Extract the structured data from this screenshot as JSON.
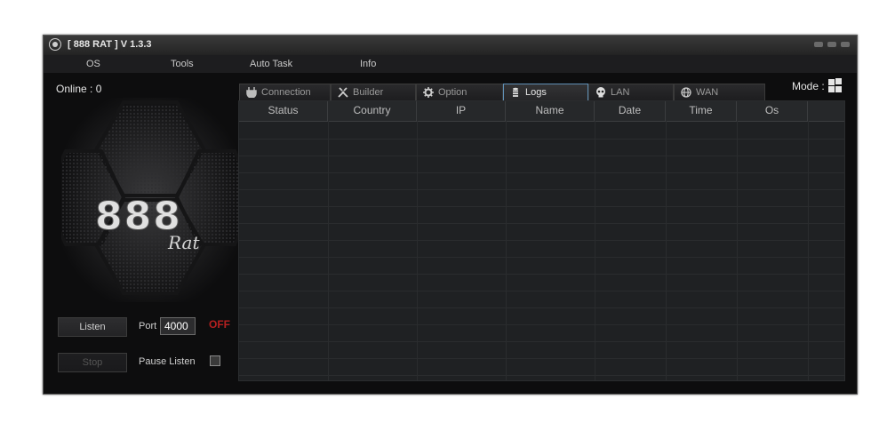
{
  "window": {
    "title": "[ 888 RAT ] V 1.3.3"
  },
  "menu": [
    "OS",
    "Tools",
    "Auto Task",
    "Info"
  ],
  "status": {
    "online_label": "Online : 0",
    "mode_label": "Mode :"
  },
  "logo": {
    "digits": "888",
    "script": "Rat"
  },
  "controls": {
    "listen_label": "Listen",
    "stop_label": "Stop",
    "port_label": "Port",
    "port_value": "4000",
    "state": "OFF",
    "pause_label": "Pause Listen"
  },
  "tabs": [
    {
      "label": "Connection",
      "icon": "plug-icon"
    },
    {
      "label": "Builder",
      "icon": "tools-icon"
    },
    {
      "label": "Option",
      "icon": "gear-icon"
    },
    {
      "label": "Logs",
      "icon": "logs-icon",
      "active": true
    },
    {
      "label": "LAN",
      "icon": "skull-icon"
    },
    {
      "label": "WAN",
      "icon": "globe-icon"
    }
  ],
  "table": {
    "columns": [
      "Status",
      "Country",
      "IP",
      "Name",
      "Date",
      "Time",
      "Os"
    ]
  },
  "colors": {
    "off_red": "#b52020",
    "active_tab_border": "#5f8fb4"
  }
}
